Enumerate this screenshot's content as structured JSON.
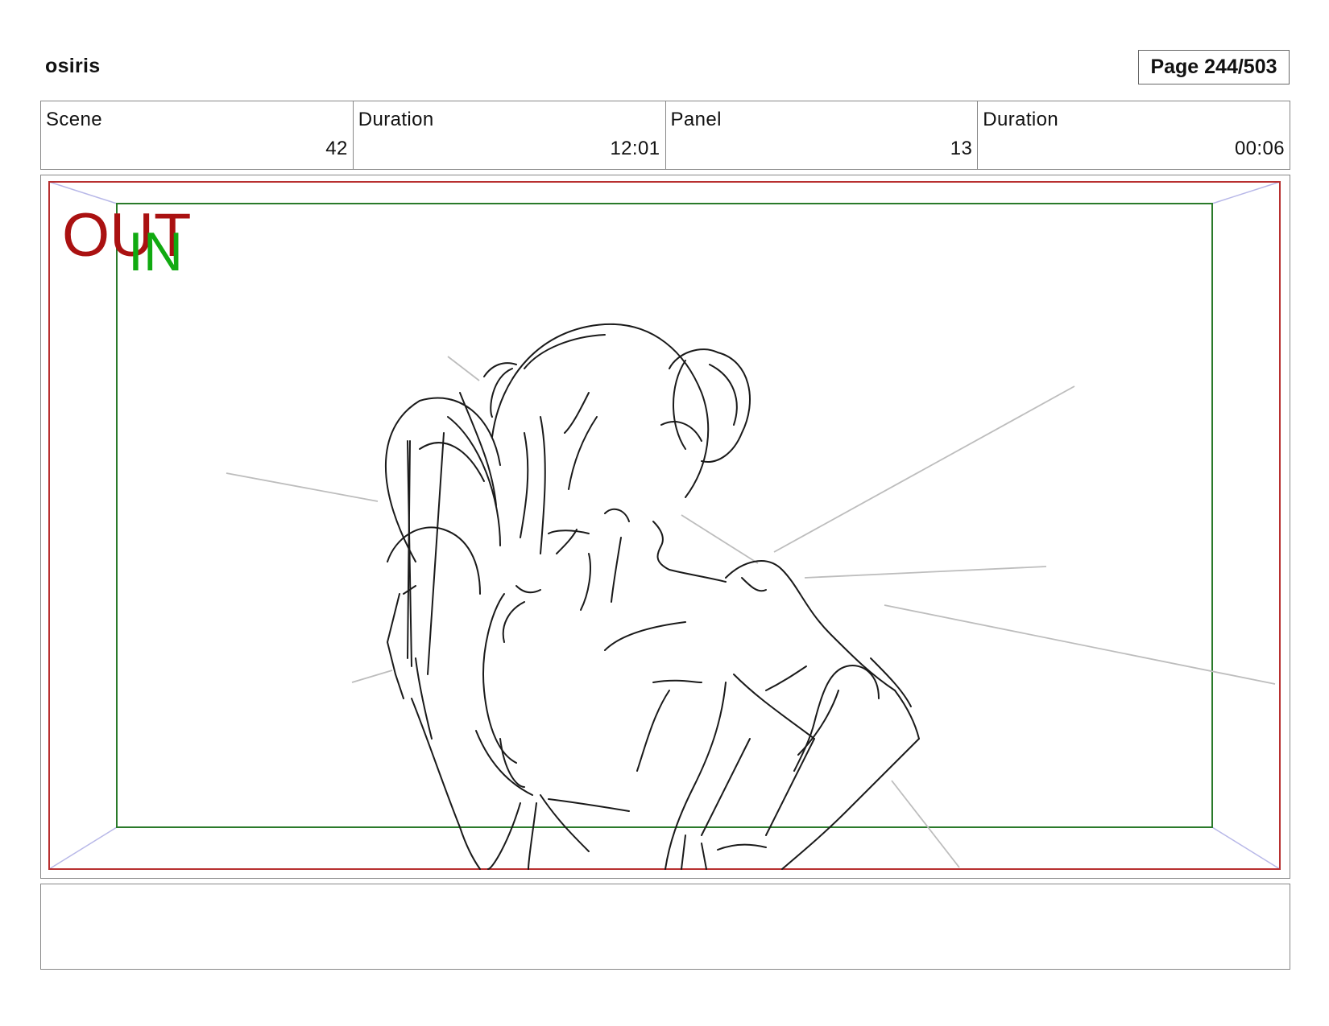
{
  "header": {
    "project_title": "osiris",
    "page_label": "Page 244/503"
  },
  "info": {
    "scene_label": "Scene",
    "scene_value": "42",
    "scene_duration_label": "Duration",
    "scene_duration_value": "12:01",
    "panel_label": "Panel",
    "panel_value": "13",
    "panel_duration_label": "Duration",
    "panel_duration_value": "00:06"
  },
  "frame": {
    "out_label": "OUT",
    "in_label": "IN",
    "out_color": "#aa1111",
    "in_color": "#11aa11",
    "out_frame_color": "#b83030",
    "in_frame_color": "#2a7a2a",
    "corner_guide_color": "#b8b8e8"
  },
  "notes": {
    "text": ""
  }
}
